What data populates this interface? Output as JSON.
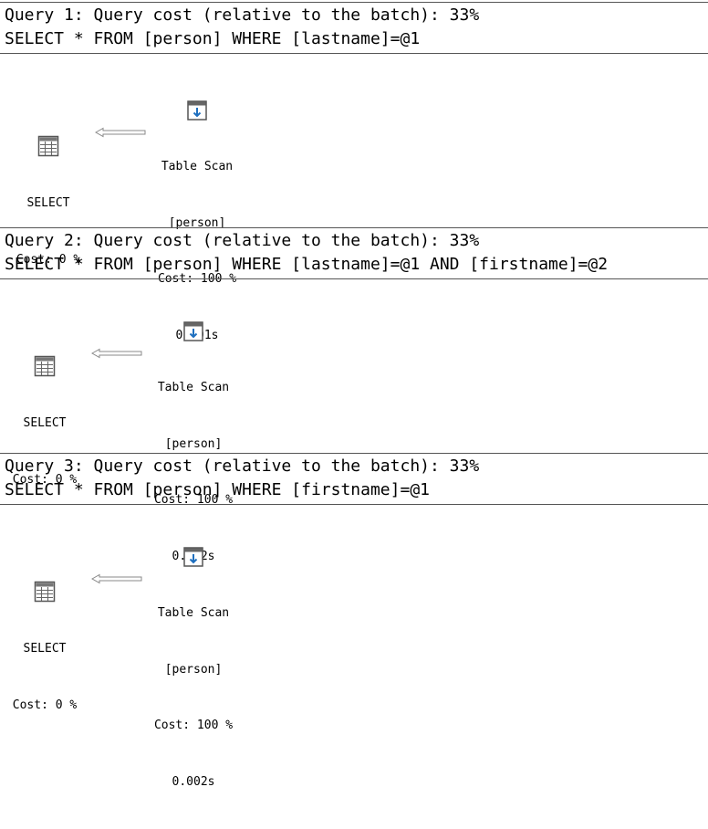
{
  "queries": [
    {
      "header": "Query 1: Query cost (relative to the batch): 33%",
      "sql": "SELECT * FROM [person] WHERE [lastname]=@1",
      "select_node": {
        "label": "SELECT",
        "cost": "Cost: 0 %",
        "icon": "select-result-icon"
      },
      "scan_node": {
        "op": "Table Scan",
        "table": "[person]",
        "cost": "Cost: 100 %",
        "time": "0.001s",
        "icon": "table-scan-icon"
      }
    },
    {
      "header": "Query 2: Query cost (relative to the batch): 33%",
      "sql": "SELECT * FROM [person] WHERE [lastname]=@1 AND [firstname]=@2",
      "select_node": {
        "label": "SELECT",
        "cost": "Cost: 0 %",
        "icon": "select-result-icon"
      },
      "scan_node": {
        "op": "Table Scan",
        "table": "[person]",
        "cost": "Cost: 100 %",
        "time": "0.002s",
        "icon": "table-scan-icon"
      }
    },
    {
      "header": "Query 3: Query cost (relative to the batch): 33%",
      "sql": "SELECT * FROM [person] WHERE [firstname]=@1",
      "select_node": {
        "label": "SELECT",
        "cost": "Cost: 0 %",
        "icon": "select-result-icon"
      },
      "scan_node": {
        "op": "Table Scan",
        "table": "[person]",
        "cost": "Cost: 100 %",
        "time": "0.002s",
        "icon": "table-scan-icon"
      }
    }
  ],
  "colors": {
    "rule": "#555555",
    "icon_blue": "#1e6fbf",
    "arrow_stroke": "#888888"
  }
}
